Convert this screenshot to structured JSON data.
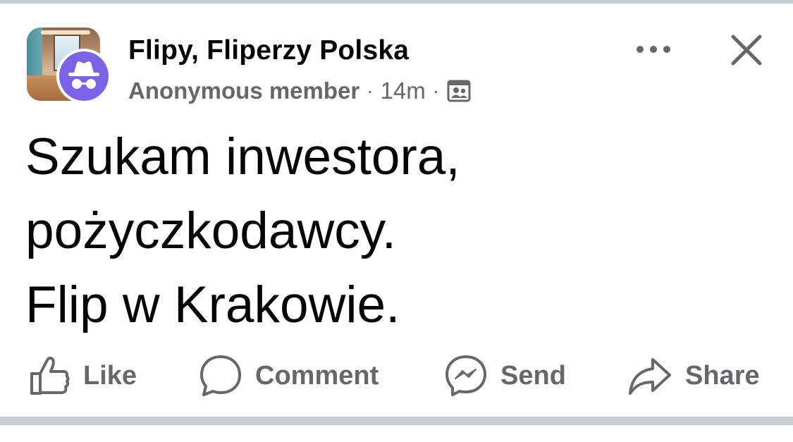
{
  "post": {
    "group_name": "Flipy, Fliperzy Polska",
    "author": "Anonymous member",
    "separator": "·",
    "time": "14m",
    "privacy_icon": "group-members-icon",
    "body_lines": [
      "Szukam inwestora,",
      "pożyczkodawcy.",
      "Flip w Krakowie."
    ]
  },
  "header_actions": {
    "more_icon": "more-horizontal-icon",
    "close_icon": "close-icon"
  },
  "actions": [
    {
      "label": "Like",
      "icon": "thumbs-up-icon"
    },
    {
      "label": "Comment",
      "icon": "comment-bubble-icon"
    },
    {
      "label": "Send",
      "icon": "messenger-icon"
    },
    {
      "label": "Share",
      "icon": "share-arrow-icon"
    }
  ],
  "colors": {
    "text_primary": "#050505",
    "text_secondary": "#65676b",
    "anon_badge": "#7b63e8",
    "divider": "#c9ccd1"
  }
}
